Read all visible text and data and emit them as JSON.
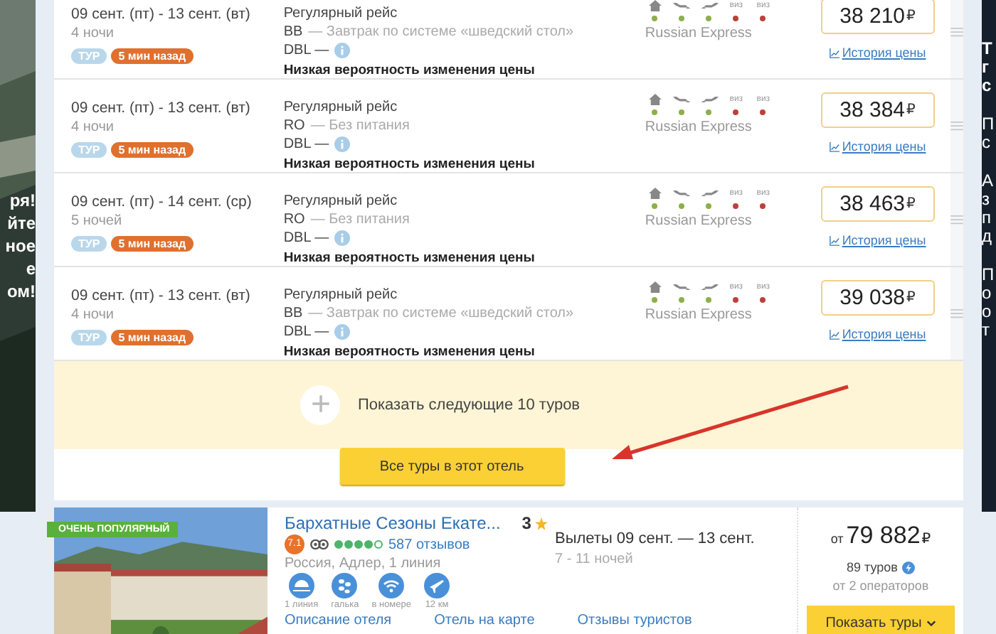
{
  "left_banner": {
    "lines": [
      "ря!",
      "йте",
      "ное",
      "е",
      "ом!"
    ]
  },
  "right_banner": {
    "blocks": [
      [
        "Т",
        "г",
        "с"
      ],
      [
        "П",
        "с"
      ],
      [
        "А",
        "з",
        "п",
        "д"
      ],
      [
        "П",
        "о",
        "о",
        "т"
      ]
    ]
  },
  "tours": [
    {
      "dates": "09 сент. (пт) - 13 сент. (вт)",
      "nights": "4 ночи",
      "tag": "ТУР",
      "updated": "5 мин назад",
      "flight": "Регулярный рейс",
      "meal_code": "BB",
      "meal": "— Завтрак по системе «шведский стол»",
      "room": "DBL —",
      "note": "Низкая вероятность изменения цены",
      "services": [
        {
          "kind": "hotel",
          "color": "#8cb04a"
        },
        {
          "kind": "flight-out",
          "color": "#8cb04a"
        },
        {
          "kind": "flight-back",
          "color": "#8cb04a"
        },
        {
          "kind": "visa-out",
          "label": "виз",
          "color": "#b8433a"
        },
        {
          "kind": "visa-back",
          "label": "виз",
          "color": "#b8433a"
        }
      ],
      "operator": "Russian Express",
      "price": "38 210",
      "currency": "₽",
      "history": "История цены"
    },
    {
      "dates": "09 сент. (пт) - 13 сент. (вт)",
      "nights": "4 ночи",
      "tag": "ТУР",
      "updated": "5 мин назад",
      "flight": "Регулярный рейс",
      "meal_code": "RO",
      "meal": "— Без питания",
      "room": "DBL —",
      "note": "Низкая вероятность изменения цены",
      "services": [
        {
          "kind": "hotel",
          "color": "#8cb04a"
        },
        {
          "kind": "flight-out",
          "color": "#8cb04a"
        },
        {
          "kind": "flight-back",
          "color": "#8cb04a"
        },
        {
          "kind": "visa-out",
          "label": "виз",
          "color": "#b8433a"
        },
        {
          "kind": "visa-back",
          "label": "виз",
          "color": "#b8433a"
        }
      ],
      "operator": "Russian Express",
      "price": "38 384",
      "currency": "₽",
      "history": "История цены"
    },
    {
      "dates": "09 сент. (пт) - 14 сент. (ср)",
      "nights": "5 ночей",
      "tag": "ТУР",
      "updated": "5 мин назад",
      "flight": "Регулярный рейс",
      "meal_code": "RO",
      "meal": "— Без питания",
      "room": "DBL —",
      "note": "Низкая вероятность изменения цены",
      "services": [
        {
          "kind": "hotel",
          "color": "#8cb04a"
        },
        {
          "kind": "flight-out",
          "color": "#8cb04a"
        },
        {
          "kind": "flight-back",
          "color": "#8cb04a"
        },
        {
          "kind": "visa-out",
          "label": "виз",
          "color": "#b8433a"
        },
        {
          "kind": "visa-back",
          "label": "виз",
          "color": "#b8433a"
        }
      ],
      "operator": "Russian Express",
      "price": "38 463",
      "currency": "₽",
      "history": "История цены"
    },
    {
      "dates": "09 сент. (пт) - 13 сент. (вт)",
      "nights": "4 ночи",
      "tag": "ТУР",
      "updated": "5 мин назад",
      "flight": "Регулярный рейс",
      "meal_code": "BB",
      "meal": "— Завтрак по системе «шведский стол»",
      "room": "DBL —",
      "note": "Низкая вероятность изменения цены",
      "services": [
        {
          "kind": "hotel",
          "color": "#8cb04a"
        },
        {
          "kind": "flight-out",
          "color": "#8cb04a"
        },
        {
          "kind": "flight-back",
          "color": "#8cb04a"
        },
        {
          "kind": "visa-out",
          "label": "виз",
          "color": "#b8433a"
        },
        {
          "kind": "visa-back",
          "label": "виз",
          "color": "#b8433a"
        }
      ],
      "operator": "Russian Express",
      "price": "39 038",
      "currency": "₽",
      "history": "История цены"
    }
  ],
  "more": {
    "plus": "+",
    "label": "Показать следующие 10 туров"
  },
  "all_tours_button": "Все туры в этот отель",
  "hotel": {
    "badge": "ОЧЕНЬ ПОПУЛЯРНЫЙ",
    "name": "Бархатные Сезоны Екате...",
    "stars_text": "3",
    "rating": "7.1",
    "stars": 4,
    "reviews": "587 отзывов",
    "location": "Россия, Адлер, 1 линия",
    "amenities": [
      {
        "kind": "beach",
        "label": "1 линия"
      },
      {
        "kind": "pebbles",
        "label": "галька"
      },
      {
        "kind": "wifi",
        "label": "в номере"
      },
      {
        "kind": "airport",
        "label": "12 км"
      }
    ],
    "departures": "Вылеты 09 сент. — 13 сент.",
    "nights": "7 - 11 ночей",
    "from": "от",
    "price": "79 882",
    "currency": "₽",
    "tours_count": "89 туров",
    "operators": "от 2 операторов",
    "button": "Показать туры",
    "links": [
      "Описание отеля",
      "Отель на карте",
      "Отзывы туристов"
    ]
  }
}
